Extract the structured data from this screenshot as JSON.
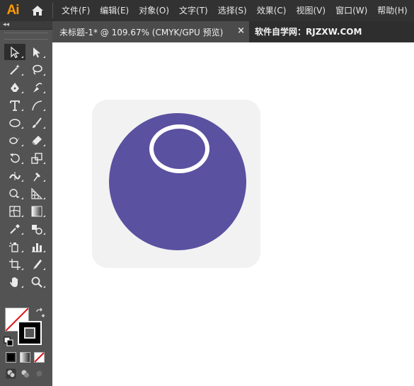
{
  "app": {
    "logo": "Ai",
    "menu": [
      "文件(F)",
      "编辑(E)",
      "对象(O)",
      "文字(T)",
      "选择(S)",
      "效果(C)",
      "视图(V)",
      "窗口(W)",
      "帮助(H)"
    ]
  },
  "tabs": {
    "document": "未标题-1* @ 109.67% (CMYK/GPU 预览)",
    "close_glyph": "×",
    "watermark": "软件自学网：RJZXW.COM"
  },
  "toolbar": {
    "collapse_glyph": "◂◂",
    "tools": [
      {
        "name": "selection-tool-icon",
        "active": true
      },
      {
        "name": "direct-selection-tool-icon"
      },
      {
        "name": "magic-wand-tool-icon"
      },
      {
        "name": "lasso-tool-icon"
      },
      {
        "name": "pen-tool-icon"
      },
      {
        "name": "curvature-tool-icon"
      },
      {
        "name": "type-tool-icon"
      },
      {
        "name": "line-segment-tool-icon"
      },
      {
        "name": "ellipse-tool-icon"
      },
      {
        "name": "paintbrush-tool-icon"
      },
      {
        "name": "shaper-tool-icon"
      },
      {
        "name": "eraser-tool-icon"
      },
      {
        "name": "rotate-tool-icon"
      },
      {
        "name": "scale-tool-icon"
      },
      {
        "name": "width-tool-icon"
      },
      {
        "name": "puppet-warp-tool-icon"
      },
      {
        "name": "shape-builder-tool-icon"
      },
      {
        "name": "perspective-grid-tool-icon"
      },
      {
        "name": "mesh-tool-icon"
      },
      {
        "name": "gradient-tool-icon"
      },
      {
        "name": "eyedropper-tool-icon"
      },
      {
        "name": "blend-tool-icon"
      },
      {
        "name": "symbol-sprayer-tool-icon"
      },
      {
        "name": "column-graph-tool-icon"
      },
      {
        "name": "artboard-tool-icon"
      },
      {
        "name": "slice-tool-icon"
      },
      {
        "name": "hand-tool-icon"
      },
      {
        "name": "zoom-tool-icon"
      }
    ],
    "fill_color": "#ffffff",
    "stroke_color": "#000000"
  },
  "artwork": {
    "background_color": "#f2f2f2",
    "circle_color": "#5a51a0",
    "ring_color": "#ffffff"
  }
}
